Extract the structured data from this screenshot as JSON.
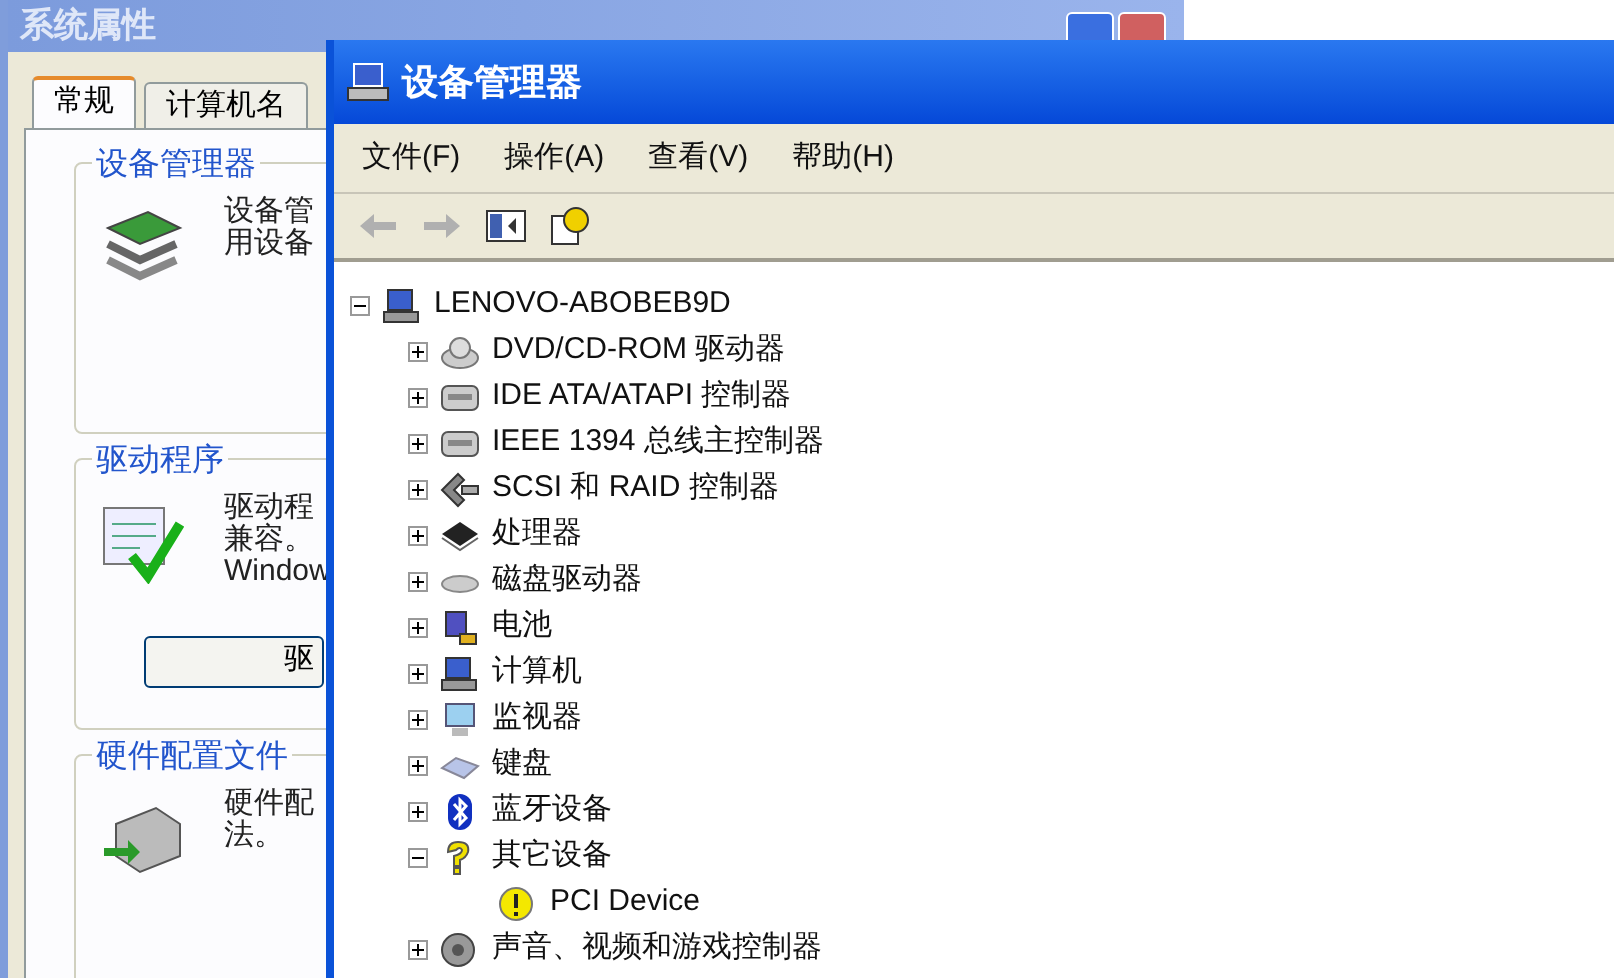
{
  "back_window": {
    "title": "系统属性",
    "tabs": [
      {
        "label": "常规",
        "selected": true
      },
      {
        "label": "计算机名",
        "selected": false
      }
    ],
    "groups": [
      {
        "title": "设备管理器",
        "kind": "devices",
        "lines": [
          "设备管",
          "用设备"
        ]
      },
      {
        "title": "驱动程序",
        "kind": "drivers",
        "lines": [
          "驱动程",
          "兼容。",
          "Window"
        ],
        "button": "驱"
      },
      {
        "title": "硬件配置文件",
        "kind": "profiles",
        "lines": [
          "硬件配",
          "法。"
        ]
      }
    ]
  },
  "window": {
    "title": "设备管理器",
    "menu": [
      "文件(F)",
      "操作(A)",
      "查看(V)",
      "帮助(H)"
    ],
    "toolbar": [
      {
        "kind": "back",
        "disabled": true
      },
      {
        "kind": "forward",
        "disabled": true
      },
      {
        "kind": "pane",
        "disabled": false
      },
      {
        "kind": "help",
        "disabled": false
      }
    ]
  },
  "tree": {
    "label": "LENOVO-ABOBEB9D",
    "kind": "computer",
    "expanded": true,
    "children": [
      {
        "label": "DVD/CD-ROM 驱动器",
        "kind": "disc",
        "expanded": false
      },
      {
        "label": "IDE ATA/ATAPI 控制器",
        "kind": "controller",
        "expanded": false
      },
      {
        "label": "IEEE 1394 总线主控制器",
        "kind": "controller",
        "expanded": false
      },
      {
        "label": "SCSI 和 RAID 控制器",
        "kind": "scsi",
        "expanded": false
      },
      {
        "label": "处理器",
        "kind": "chip",
        "expanded": false
      },
      {
        "label": "磁盘驱动器",
        "kind": "drive",
        "expanded": false
      },
      {
        "label": "电池",
        "kind": "battery",
        "expanded": false
      },
      {
        "label": "计算机",
        "kind": "computer",
        "expanded": false
      },
      {
        "label": "监视器",
        "kind": "monitor",
        "expanded": false
      },
      {
        "label": "键盘",
        "kind": "keyboard",
        "expanded": false
      },
      {
        "label": "蓝牙设备",
        "kind": "bluetooth",
        "expanded": false
      },
      {
        "label": "其它设备",
        "kind": "unknown",
        "expanded": true,
        "children": [
          {
            "label": "PCI Device",
            "kind": "warning"
          }
        ]
      },
      {
        "label": "声音、视频和游戏控制器",
        "kind": "speaker",
        "expanded": false
      }
    ]
  }
}
